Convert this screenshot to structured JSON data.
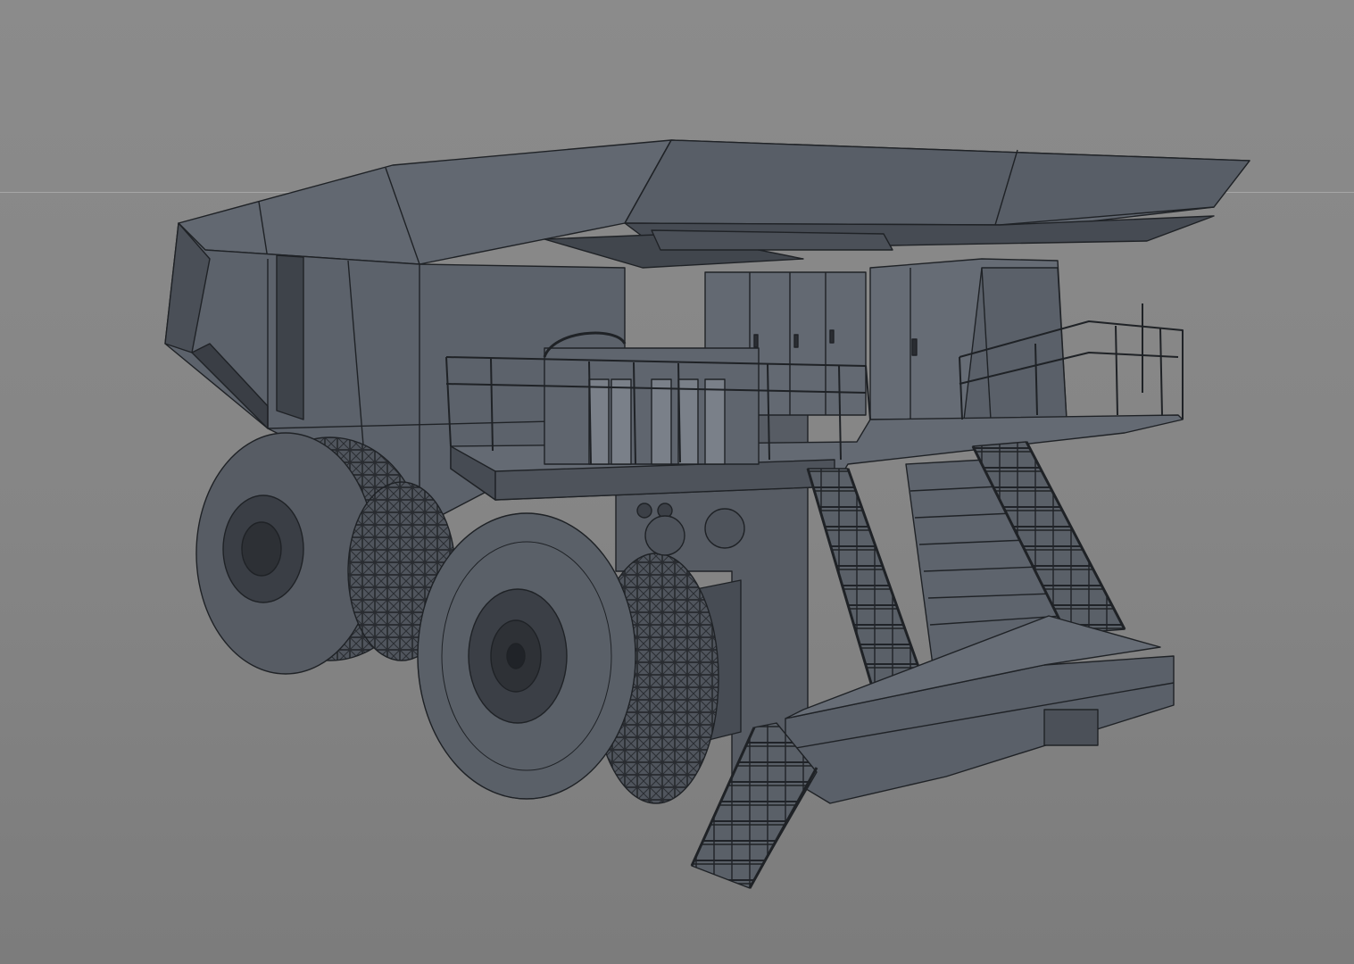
{
  "viewport": {
    "background": "#878787",
    "horizon_line_color": "#a6a6a6",
    "display_mode": "wireframe-on-shaded"
  },
  "model": {
    "subject": "mining-haul-truck",
    "base_color": "#5c626b",
    "dark_color": "#3e434a",
    "light_color": "#6d737c",
    "wire_color": "#1f2226"
  }
}
